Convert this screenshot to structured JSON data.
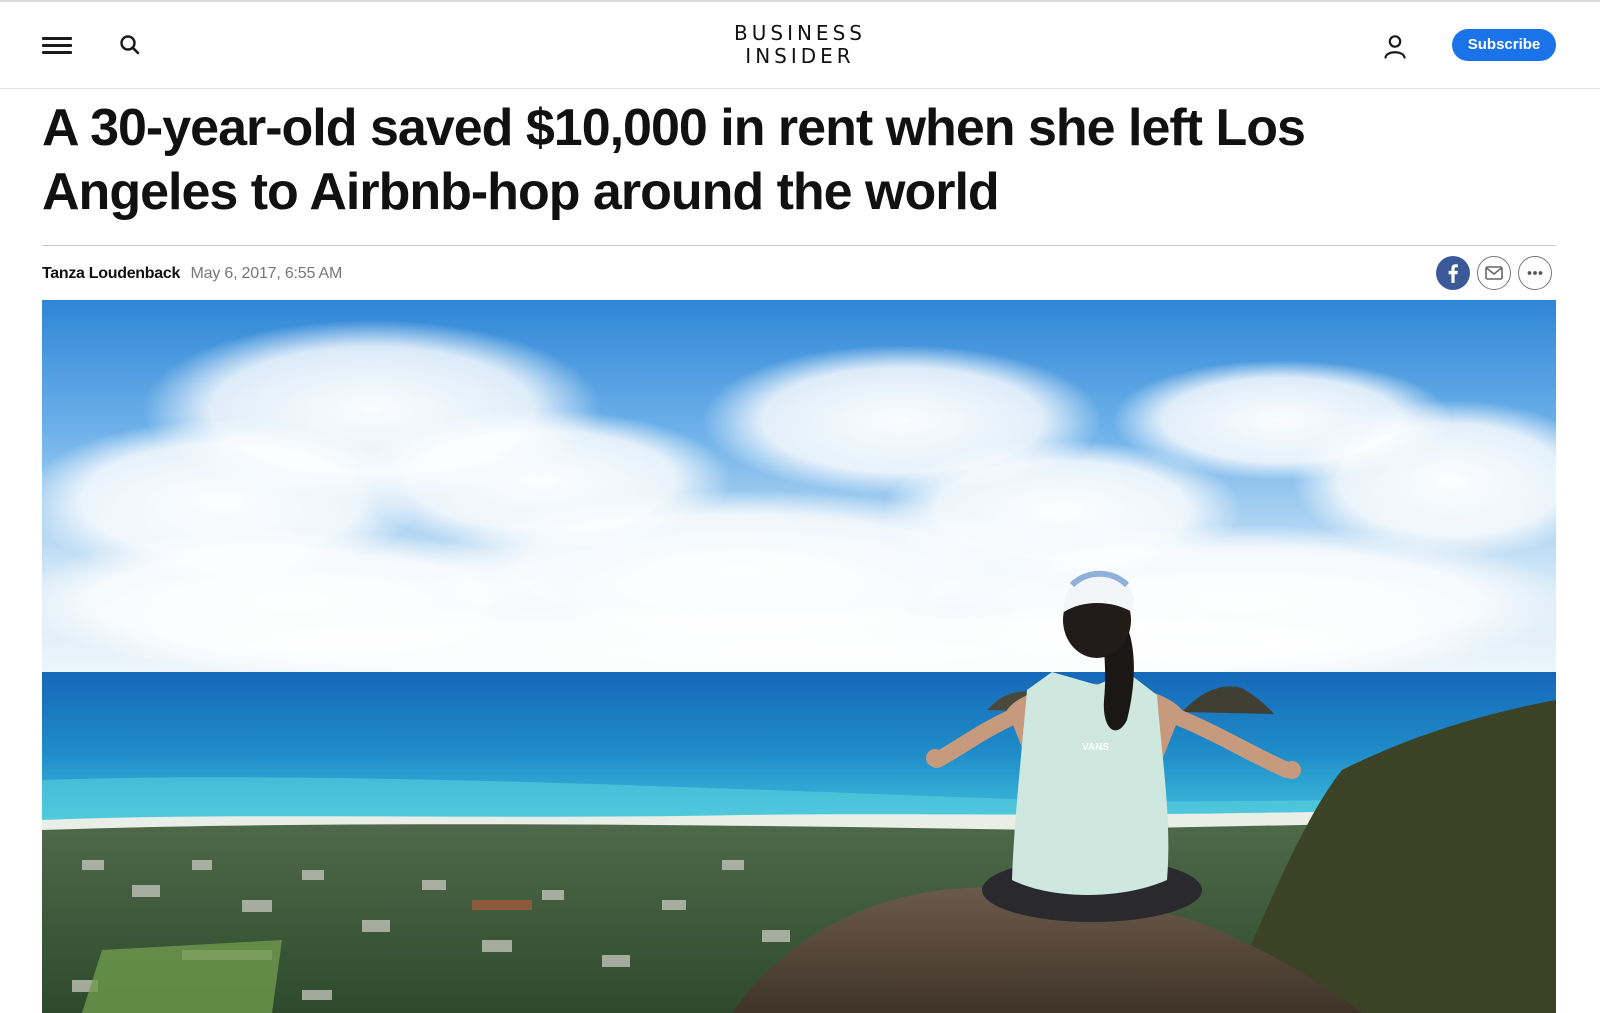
{
  "header": {
    "logo_line1": "BUSINESS",
    "logo_line2": "INSIDER",
    "subscribe_label": "Subscribe"
  },
  "article": {
    "headline": "A 30-year-old saved $10,000 in rent when she left Los Angeles to Airbnb-hop around the world",
    "author": "Tanza Loudenback",
    "date": "May 6, 2017, 6:55 AM"
  },
  "icons": {
    "menu": "hamburger-menu-icon",
    "search": "search-icon",
    "account": "account-icon",
    "facebook": "facebook-icon",
    "email": "email-icon",
    "more": "more-icon"
  },
  "hero": {
    "shirt_text": "VANS"
  },
  "colors": {
    "accent": "#1a73e8",
    "facebook": "#3b5998",
    "meta_gray": "#777777"
  }
}
